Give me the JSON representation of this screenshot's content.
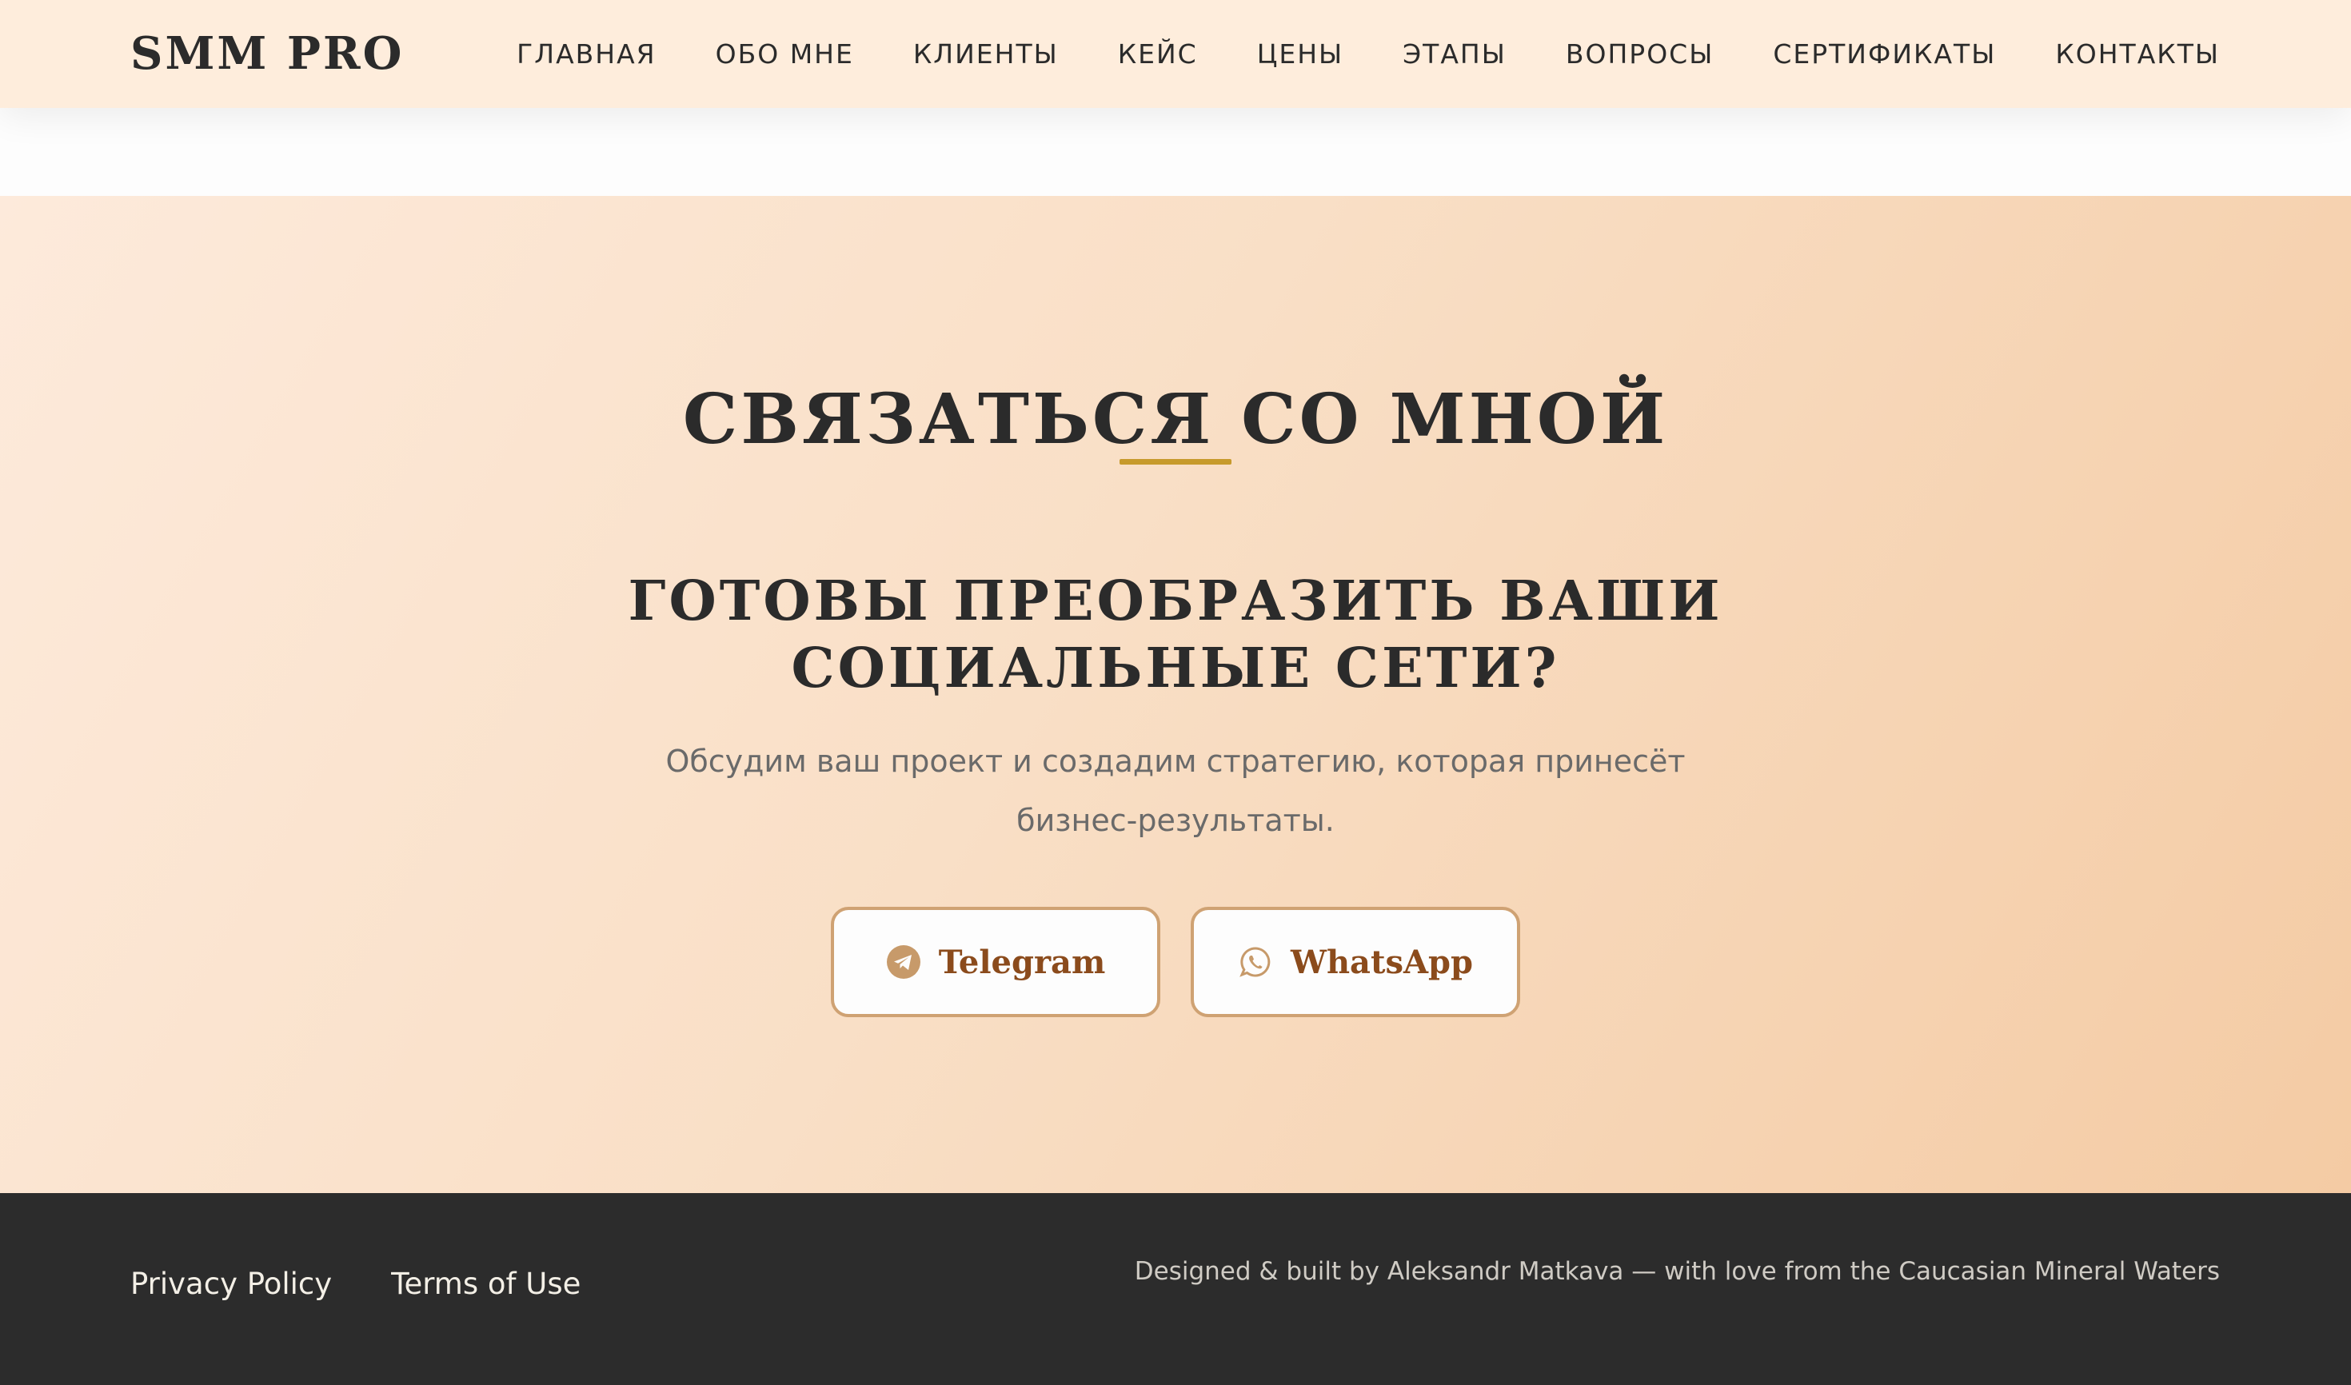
{
  "header": {
    "logo": "SMM PRO",
    "nav": [
      "ГЛАВНАЯ",
      "ОБО МНЕ",
      "КЛИЕНТЫ",
      "КЕЙС",
      "ЦЕНЫ",
      "ЭТАПЫ",
      "ВОПРОСЫ",
      "СЕРТИФИКАТЫ",
      "КОНТАКТЫ"
    ]
  },
  "contact": {
    "title": "СВЯЗАТЬСЯ СО МНОЙ",
    "subtitle_line1": "ГОТОВЫ ПРЕОБРАЗИТЬ ВАШИ",
    "subtitle_line2": "СОЦИАЛЬНЫЕ СЕТИ?",
    "lead_line1": "Обсудим ваш проект и создадим стратегию, которая принесёт",
    "lead_line2": "бизнес-результаты.",
    "buttons": {
      "telegram": {
        "label": "Telegram",
        "icon": "telegram-icon"
      },
      "whatsapp": {
        "label": "WhatsApp",
        "icon": "whatsapp-icon"
      }
    }
  },
  "footer": {
    "privacy": "Privacy Policy",
    "terms": "Terms of Use",
    "credits": "Designed & built by Aleksandr Matkava — with love from the Caucasian Mineral Waters"
  },
  "colors": {
    "accent_gold": "#c79a2c",
    "button_border": "#cfa273",
    "button_text": "#8b4b1c",
    "footer_bg": "#2c2c2c",
    "header_bg": "#feeddc"
  }
}
